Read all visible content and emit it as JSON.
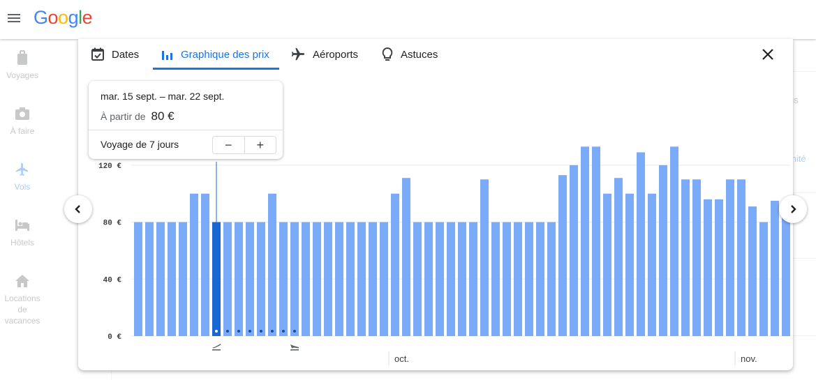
{
  "header": {
    "logo_text": "Google",
    "menu_icon": "hamburger-menu-icon"
  },
  "side_rail": {
    "items": [
      {
        "label": "Voyages",
        "icon": "suitcase-icon"
      },
      {
        "label": "À faire",
        "icon": "camera-icon"
      },
      {
        "label": "Vols",
        "icon": "airplane-icon",
        "active": true
      },
      {
        "label": "Hôtels",
        "icon": "bed-icon"
      },
      {
        "label": "Locations de vacances",
        "icon": "house-icon"
      }
    ]
  },
  "background_right": {
    "text1": "us",
    "text2": "mité"
  },
  "dialog": {
    "tabs": [
      {
        "label": "Dates",
        "icon": "calendar-check-icon"
      },
      {
        "label": "Graphique des prix",
        "icon": "bar-chart-icon",
        "active": true
      },
      {
        "label": "Aéroports",
        "icon": "airplane-icon"
      },
      {
        "label": "Astuces",
        "icon": "lightbulb-icon"
      }
    ],
    "close_icon": "close-icon"
  },
  "tooltip": {
    "dates": "mar. 15 sept. – mar. 22 sept.",
    "price_prefix": "À partir de",
    "price": "80 €",
    "duration": "Voyage de 7 jours",
    "minus": "−",
    "plus": "+"
  },
  "colors": {
    "bar": "#7baaf7",
    "bar_selected": "#1967d2",
    "accent": "#1a73e8"
  },
  "chart_data": {
    "type": "bar",
    "y_tick_labels": [
      "0 €",
      "40 €",
      "80 €",
      "120 €"
    ],
    "ylim": [
      0,
      140
    ],
    "month_labels": [
      {
        "label": "oct.",
        "bar_index": 23
      },
      {
        "label": "nov.",
        "bar_index": 54
      }
    ],
    "selected_index": 7,
    "trip_days": [
      7,
      8,
      9,
      10,
      11,
      12,
      13,
      14
    ],
    "departure_index": 7,
    "return_index": 14,
    "values": [
      80,
      80,
      80,
      80,
      80,
      100,
      100,
      80,
      80,
      80,
      80,
      80,
      100,
      80,
      80,
      80,
      80,
      80,
      80,
      80,
      80,
      80,
      80,
      100,
      111,
      80,
      80,
      80,
      80,
      80,
      80,
      110,
      80,
      80,
      80,
      80,
      80,
      80,
      113,
      120,
      133,
      133,
      100,
      111,
      100,
      129,
      100,
      120,
      133,
      110,
      110,
      96,
      96,
      110,
      110,
      91,
      80,
      95,
      95
    ]
  }
}
